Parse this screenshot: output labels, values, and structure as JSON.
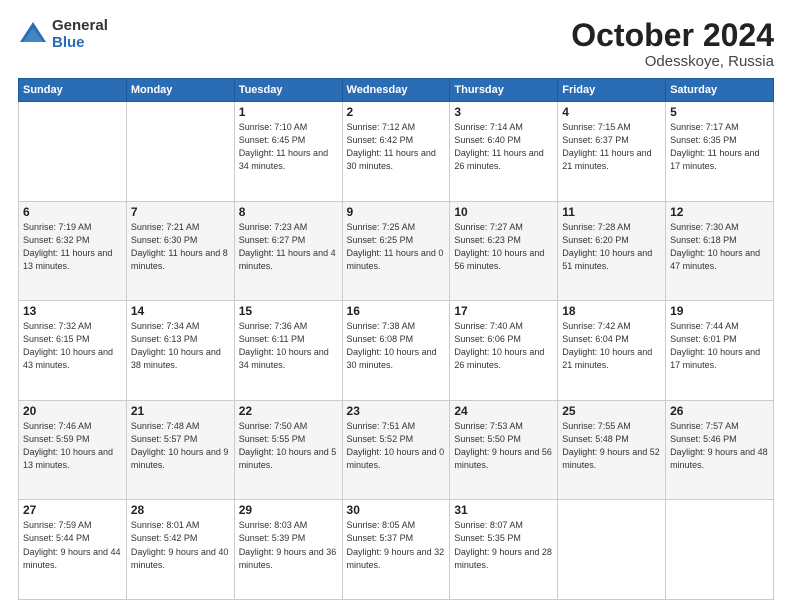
{
  "logo": {
    "general": "General",
    "blue": "Blue"
  },
  "header": {
    "month": "October 2024",
    "location": "Odesskoye, Russia"
  },
  "days_of_week": [
    "Sunday",
    "Monday",
    "Tuesday",
    "Wednesday",
    "Thursday",
    "Friday",
    "Saturday"
  ],
  "weeks": [
    [
      {
        "day": "",
        "info": ""
      },
      {
        "day": "",
        "info": ""
      },
      {
        "day": "1",
        "info": "Sunrise: 7:10 AM\nSunset: 6:45 PM\nDaylight: 11 hours\nand 34 minutes."
      },
      {
        "day": "2",
        "info": "Sunrise: 7:12 AM\nSunset: 6:42 PM\nDaylight: 11 hours\nand 30 minutes."
      },
      {
        "day": "3",
        "info": "Sunrise: 7:14 AM\nSunset: 6:40 PM\nDaylight: 11 hours\nand 26 minutes."
      },
      {
        "day": "4",
        "info": "Sunrise: 7:15 AM\nSunset: 6:37 PM\nDaylight: 11 hours\nand 21 minutes."
      },
      {
        "day": "5",
        "info": "Sunrise: 7:17 AM\nSunset: 6:35 PM\nDaylight: 11 hours\nand 17 minutes."
      }
    ],
    [
      {
        "day": "6",
        "info": "Sunrise: 7:19 AM\nSunset: 6:32 PM\nDaylight: 11 hours\nand 13 minutes."
      },
      {
        "day": "7",
        "info": "Sunrise: 7:21 AM\nSunset: 6:30 PM\nDaylight: 11 hours\nand 8 minutes."
      },
      {
        "day": "8",
        "info": "Sunrise: 7:23 AM\nSunset: 6:27 PM\nDaylight: 11 hours\nand 4 minutes."
      },
      {
        "day": "9",
        "info": "Sunrise: 7:25 AM\nSunset: 6:25 PM\nDaylight: 11 hours\nand 0 minutes."
      },
      {
        "day": "10",
        "info": "Sunrise: 7:27 AM\nSunset: 6:23 PM\nDaylight: 10 hours\nand 56 minutes."
      },
      {
        "day": "11",
        "info": "Sunrise: 7:28 AM\nSunset: 6:20 PM\nDaylight: 10 hours\nand 51 minutes."
      },
      {
        "day": "12",
        "info": "Sunrise: 7:30 AM\nSunset: 6:18 PM\nDaylight: 10 hours\nand 47 minutes."
      }
    ],
    [
      {
        "day": "13",
        "info": "Sunrise: 7:32 AM\nSunset: 6:15 PM\nDaylight: 10 hours\nand 43 minutes."
      },
      {
        "day": "14",
        "info": "Sunrise: 7:34 AM\nSunset: 6:13 PM\nDaylight: 10 hours\nand 38 minutes."
      },
      {
        "day": "15",
        "info": "Sunrise: 7:36 AM\nSunset: 6:11 PM\nDaylight: 10 hours\nand 34 minutes."
      },
      {
        "day": "16",
        "info": "Sunrise: 7:38 AM\nSunset: 6:08 PM\nDaylight: 10 hours\nand 30 minutes."
      },
      {
        "day": "17",
        "info": "Sunrise: 7:40 AM\nSunset: 6:06 PM\nDaylight: 10 hours\nand 26 minutes."
      },
      {
        "day": "18",
        "info": "Sunrise: 7:42 AM\nSunset: 6:04 PM\nDaylight: 10 hours\nand 21 minutes."
      },
      {
        "day": "19",
        "info": "Sunrise: 7:44 AM\nSunset: 6:01 PM\nDaylight: 10 hours\nand 17 minutes."
      }
    ],
    [
      {
        "day": "20",
        "info": "Sunrise: 7:46 AM\nSunset: 5:59 PM\nDaylight: 10 hours\nand 13 minutes."
      },
      {
        "day": "21",
        "info": "Sunrise: 7:48 AM\nSunset: 5:57 PM\nDaylight: 10 hours\nand 9 minutes."
      },
      {
        "day": "22",
        "info": "Sunrise: 7:50 AM\nSunset: 5:55 PM\nDaylight: 10 hours\nand 5 minutes."
      },
      {
        "day": "23",
        "info": "Sunrise: 7:51 AM\nSunset: 5:52 PM\nDaylight: 10 hours\nand 0 minutes."
      },
      {
        "day": "24",
        "info": "Sunrise: 7:53 AM\nSunset: 5:50 PM\nDaylight: 9 hours\nand 56 minutes."
      },
      {
        "day": "25",
        "info": "Sunrise: 7:55 AM\nSunset: 5:48 PM\nDaylight: 9 hours\nand 52 minutes."
      },
      {
        "day": "26",
        "info": "Sunrise: 7:57 AM\nSunset: 5:46 PM\nDaylight: 9 hours\nand 48 minutes."
      }
    ],
    [
      {
        "day": "27",
        "info": "Sunrise: 7:59 AM\nSunset: 5:44 PM\nDaylight: 9 hours\nand 44 minutes."
      },
      {
        "day": "28",
        "info": "Sunrise: 8:01 AM\nSunset: 5:42 PM\nDaylight: 9 hours\nand 40 minutes."
      },
      {
        "day": "29",
        "info": "Sunrise: 8:03 AM\nSunset: 5:39 PM\nDaylight: 9 hours\nand 36 minutes."
      },
      {
        "day": "30",
        "info": "Sunrise: 8:05 AM\nSunset: 5:37 PM\nDaylight: 9 hours\nand 32 minutes."
      },
      {
        "day": "31",
        "info": "Sunrise: 8:07 AM\nSunset: 5:35 PM\nDaylight: 9 hours\nand 28 minutes."
      },
      {
        "day": "",
        "info": ""
      },
      {
        "day": "",
        "info": ""
      }
    ]
  ]
}
